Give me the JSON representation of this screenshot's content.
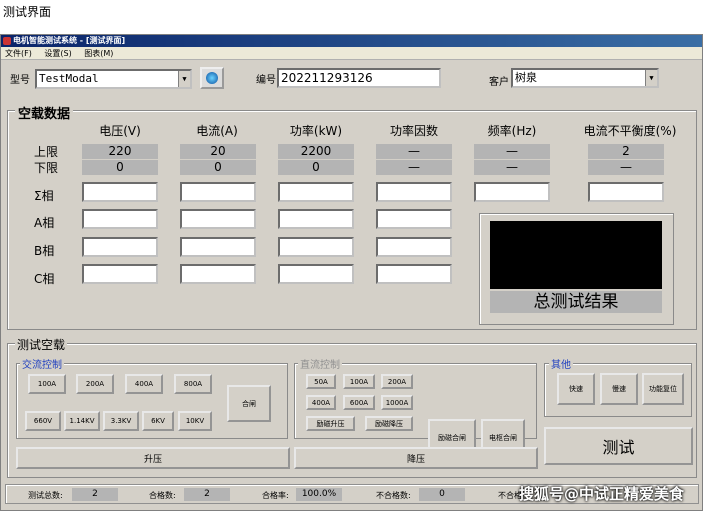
{
  "caption": "测试界面",
  "window": {
    "title": "电机智能测试系统 - [测试界面]"
  },
  "menu": [
    "文件(F)",
    "设置(S)",
    "图表(M)"
  ],
  "header": {
    "model_label": "型号",
    "model_value": "TestModal",
    "serial_label": "编号",
    "serial_value": "202211293126",
    "customer_label": "客户",
    "customer_value": "树泉"
  },
  "no_load": {
    "title": "空载数据",
    "columns": [
      "电压(V)",
      "电流(A)",
      "功率(kW)",
      "功率因数",
      "频率(Hz)",
      "电流不平衡度(%)"
    ],
    "upper_label": "上限",
    "lower_label": "下限",
    "upper": [
      "220",
      "20",
      "2200",
      "—",
      "—",
      "2"
    ],
    "lower": [
      "0",
      "0",
      "0",
      "—",
      "—",
      "—"
    ],
    "rows": [
      "Σ相",
      "A相",
      "B相",
      "C相"
    ],
    "result_label": "总测试结果"
  },
  "test": {
    "title": "测试空载",
    "ac": {
      "title": "交流控制",
      "row1": [
        "100A",
        "200A",
        "400A",
        "800A"
      ],
      "row2": [
        "660V",
        "1.14KV",
        "3.3KV",
        "6KV",
        "10KV"
      ],
      "close": "合闸"
    },
    "dc": {
      "title": "直流控制",
      "row1": [
        "50A",
        "100A",
        "200A"
      ],
      "row2": [
        "400A",
        "600A",
        "1000A"
      ],
      "row3": [
        "励磁升压",
        "励磁降压"
      ],
      "excite_close": "励磁合闸",
      "armature_close": "电枢合闸"
    },
    "other": {
      "title": "其他",
      "buttons": [
        "快速",
        "慢速",
        "功能复位"
      ]
    },
    "test_button": "测试",
    "raise": "升压",
    "lower": "降压"
  },
  "status": {
    "total_label": "测试总数:",
    "total_value": "2",
    "pass_label": "合格数:",
    "pass_value": "2",
    "rate_label": "合格率:",
    "rate_value": "100.0%",
    "fail_label": "不合格数:",
    "fail_value": "0",
    "fail_rate_label": "不合格"
  },
  "watermark": "搜狐号@中试正精爱美食"
}
